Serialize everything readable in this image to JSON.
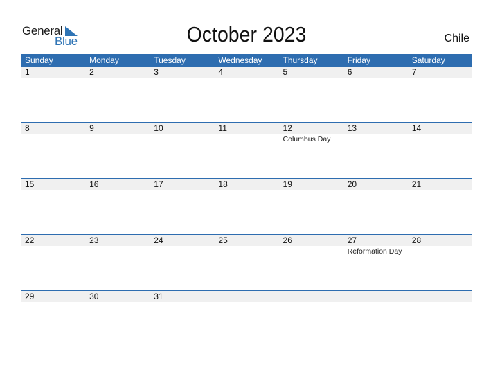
{
  "logo": {
    "line1": "General",
    "line2": "Blue"
  },
  "title": "October 2023",
  "country": "Chile",
  "weekdays": [
    "Sunday",
    "Monday",
    "Tuesday",
    "Wednesday",
    "Thursday",
    "Friday",
    "Saturday"
  ],
  "weeks": [
    [
      {
        "day": "1",
        "event": ""
      },
      {
        "day": "2",
        "event": ""
      },
      {
        "day": "3",
        "event": ""
      },
      {
        "day": "4",
        "event": ""
      },
      {
        "day": "5",
        "event": ""
      },
      {
        "day": "6",
        "event": ""
      },
      {
        "day": "7",
        "event": ""
      }
    ],
    [
      {
        "day": "8",
        "event": ""
      },
      {
        "day": "9",
        "event": ""
      },
      {
        "day": "10",
        "event": ""
      },
      {
        "day": "11",
        "event": ""
      },
      {
        "day": "12",
        "event": "Columbus Day"
      },
      {
        "day": "13",
        "event": ""
      },
      {
        "day": "14",
        "event": ""
      }
    ],
    [
      {
        "day": "15",
        "event": ""
      },
      {
        "day": "16",
        "event": ""
      },
      {
        "day": "17",
        "event": ""
      },
      {
        "day": "18",
        "event": ""
      },
      {
        "day": "19",
        "event": ""
      },
      {
        "day": "20",
        "event": ""
      },
      {
        "day": "21",
        "event": ""
      }
    ],
    [
      {
        "day": "22",
        "event": ""
      },
      {
        "day": "23",
        "event": ""
      },
      {
        "day": "24",
        "event": ""
      },
      {
        "day": "25",
        "event": ""
      },
      {
        "day": "26",
        "event": ""
      },
      {
        "day": "27",
        "event": "Reformation Day"
      },
      {
        "day": "28",
        "event": ""
      }
    ],
    [
      {
        "day": "29",
        "event": ""
      },
      {
        "day": "30",
        "event": ""
      },
      {
        "day": "31",
        "event": ""
      },
      {
        "day": "",
        "event": ""
      },
      {
        "day": "",
        "event": ""
      },
      {
        "day": "",
        "event": ""
      },
      {
        "day": "",
        "event": ""
      }
    ]
  ],
  "colors": {
    "accent": "#2e6db0",
    "strip": "#f0f0f0"
  }
}
